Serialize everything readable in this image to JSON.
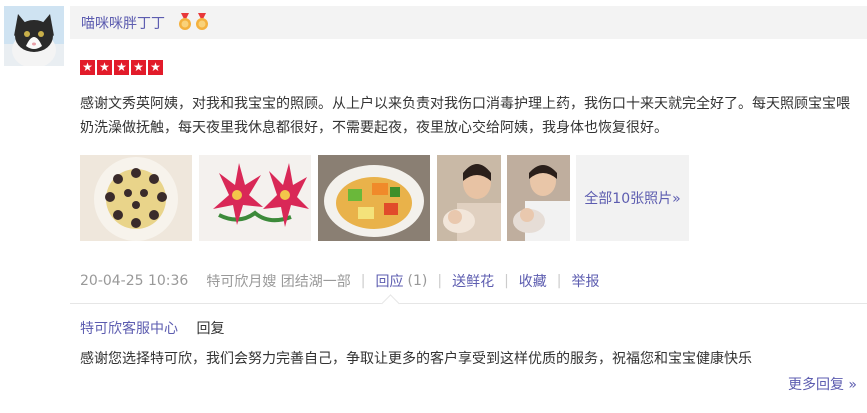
{
  "user": {
    "name": "喵咪咪胖丁丁",
    "avatar_icon": "cat-avatar",
    "badge_icon": "medal-icon"
  },
  "rating": {
    "stars": 5,
    "max": 5
  },
  "review": {
    "text": "感谢文秀英阿姨，对我和我宝宝的照顾。从上户以来负责对我伤口消毒护理上药，我伤口十来天就完全好了。每天照顾宝宝喂奶洗澡做抚触，每天夜里我休息都很好，不需要起夜，夜里放心交给阿姨，我身体也恢复很好。"
  },
  "photos": {
    "more_label": "全部10张照片»"
  },
  "meta": {
    "date": "20-04-25 10:36",
    "source": "特可欣月嫂 团结湖一部",
    "reply_label": "回应",
    "reply_count": "(1)",
    "flower_label": "送鲜花",
    "favorite_label": "收藏",
    "report_label": "举报"
  },
  "reply": {
    "author": "特可欣客服中心",
    "label": "回复",
    "text": "感谢您选择特可欣，我们会努力完善自己，争取让更多的客户享受到这样优质的服务，祝福您和宝宝健康快乐",
    "more_label": "更多回复 »"
  },
  "colors": {
    "link": "#5d5db0",
    "star": "#e21b2a",
    "meta": "#999999"
  }
}
